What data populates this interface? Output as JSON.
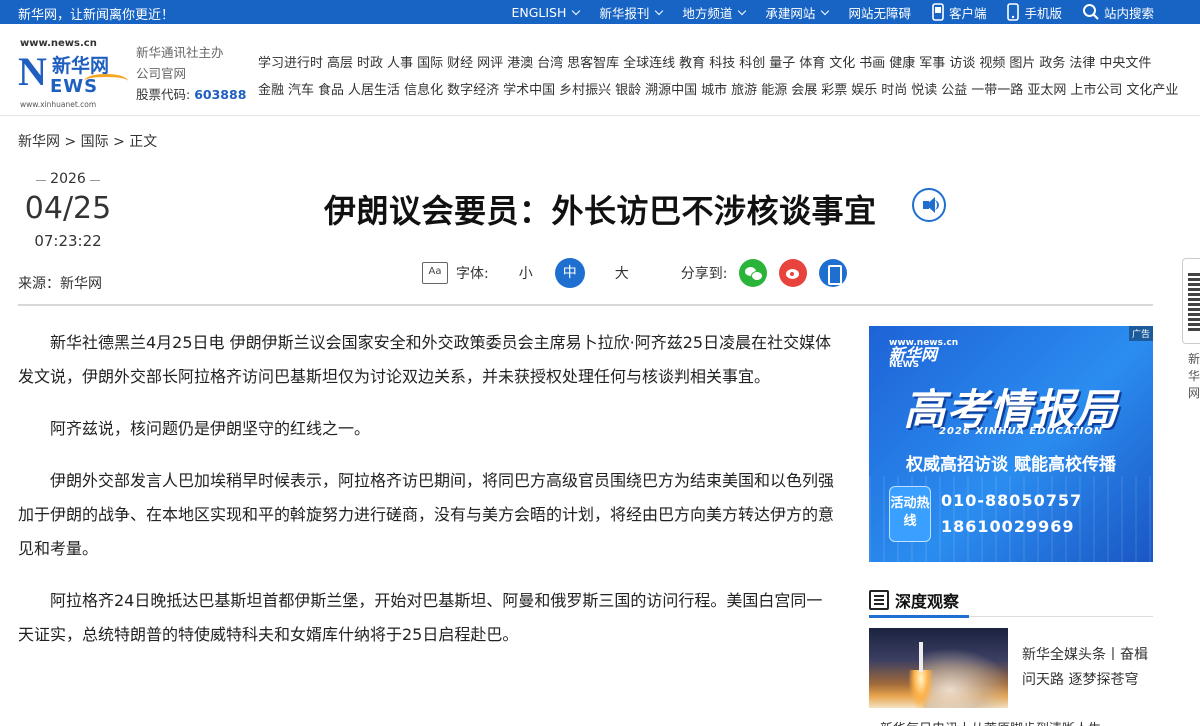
{
  "topbar": {
    "slogan": "新华网，让新闻离你更近！",
    "nav": [
      {
        "label": "ENGLISH",
        "dropdown": true
      },
      {
        "label": "新华报刊",
        "dropdown": true
      },
      {
        "label": "地方频道",
        "dropdown": true
      },
      {
        "label": "承建网站",
        "dropdown": true
      },
      {
        "label": "网站无障碍",
        "dropdown": false
      },
      {
        "label": "客户端",
        "icon": "phone-icon"
      },
      {
        "label": "手机版",
        "icon": "mobile-icon"
      },
      {
        "label": "站内搜索",
        "icon": "search-icon"
      }
    ]
  },
  "header": {
    "logo": {
      "url_top": "www.news.cn",
      "url_bottom": "www.xinhuanet.com",
      "n": "N",
      "cn": "新华网",
      "ews": "EWS"
    },
    "owner_line1": "新华通讯社主办",
    "owner_line2": "公司官网",
    "stock_label": "股票代码:",
    "stock_code": "603888",
    "channels_row1": [
      "学习进行时",
      "高层",
      "时政",
      "人事",
      "国际",
      "财经",
      "网评",
      "港澳",
      "台湾",
      "思客智库",
      "全球连线",
      "教育",
      "科技",
      "科创",
      "量子",
      "体育",
      "文化",
      "书画",
      "健康",
      "军事",
      "访谈",
      "视频",
      "图片",
      "政务",
      "法律",
      "中央文件"
    ],
    "channels_row2": [
      "金融",
      "汽车",
      "食品",
      "人居生活",
      "信息化",
      "数字经济",
      "学术中国",
      "乡村振兴",
      "银龄",
      "溯源中国",
      "城市",
      "旅游",
      "能源",
      "会展",
      "彩票",
      "娱乐",
      "时尚",
      "悦读",
      "公益",
      "一带一路",
      "亚太网",
      "上市公司",
      "文化产业"
    ]
  },
  "breadcrumb": "新华网 > 国际 > 正文",
  "date": {
    "year": "2026",
    "month_day": "04/25",
    "time": "07:23:22"
  },
  "source": "来源：新华网",
  "article": {
    "title": "伊朗议会要员：外长访巴不涉核谈事宜",
    "font_label": "字体:",
    "font_sizes": [
      "小",
      "中",
      "大"
    ],
    "font_active": "中",
    "share_label": "分享到:",
    "paragraphs": [
      "新华社德黑兰4月25日电 伊朗伊斯兰议会国家安全和外交政策委员会主席易卜拉欣·阿齐兹25日凌晨在社交媒体发文说，伊朗外交部长阿拉格齐访问巴基斯坦仅为讨论双边关系，并未获授权处理任何与核谈判相关事宜。",
      "阿齐兹说，核问题仍是伊朗坚守的红线之一。",
      "伊朗外交部发言人巴加埃稍早时候表示，阿拉格齐访巴期间，将同巴方高级官员围绕巴方为结束美国和以色列强加于伊朗的战争、在本地区实现和平的斡旋努力进行磋商，没有与美方会晤的计划，将经由巴方向美方转达伊方的意见和考量。",
      "阿拉格齐24日晚抵达巴基斯坦首都伊斯兰堡，开始对巴基斯坦、阿曼和俄罗斯三国的访问行程。美国白宫同一天证实，总统特朗普的特使威特科夫和女婿库什纳将于25日启程赴巴。"
    ]
  },
  "ad": {
    "tag": "广告",
    "logo_small": "www.news.cn",
    "logo_big": "新华网",
    "logo_ews": "NEWS",
    "headline": "高考情报局",
    "edu": "2026 XINHUA EDUCATION",
    "subline": "权威高招访谈  赋能高校传播",
    "hotline_tag": "活动热线",
    "phone1": "010-88050757",
    "phone2": "18610029969",
    "brand_color": "#1e63d6"
  },
  "deep": {
    "heading": "深度观察",
    "item_title": "新华全媒头条丨奋楫问天路 逐梦探苍穹",
    "cut_text": "新华每日电讯丨从荒原脚步到清晰人生"
  },
  "colors": {
    "topbar": "#1764c4",
    "accent": "#1f6fd1"
  }
}
